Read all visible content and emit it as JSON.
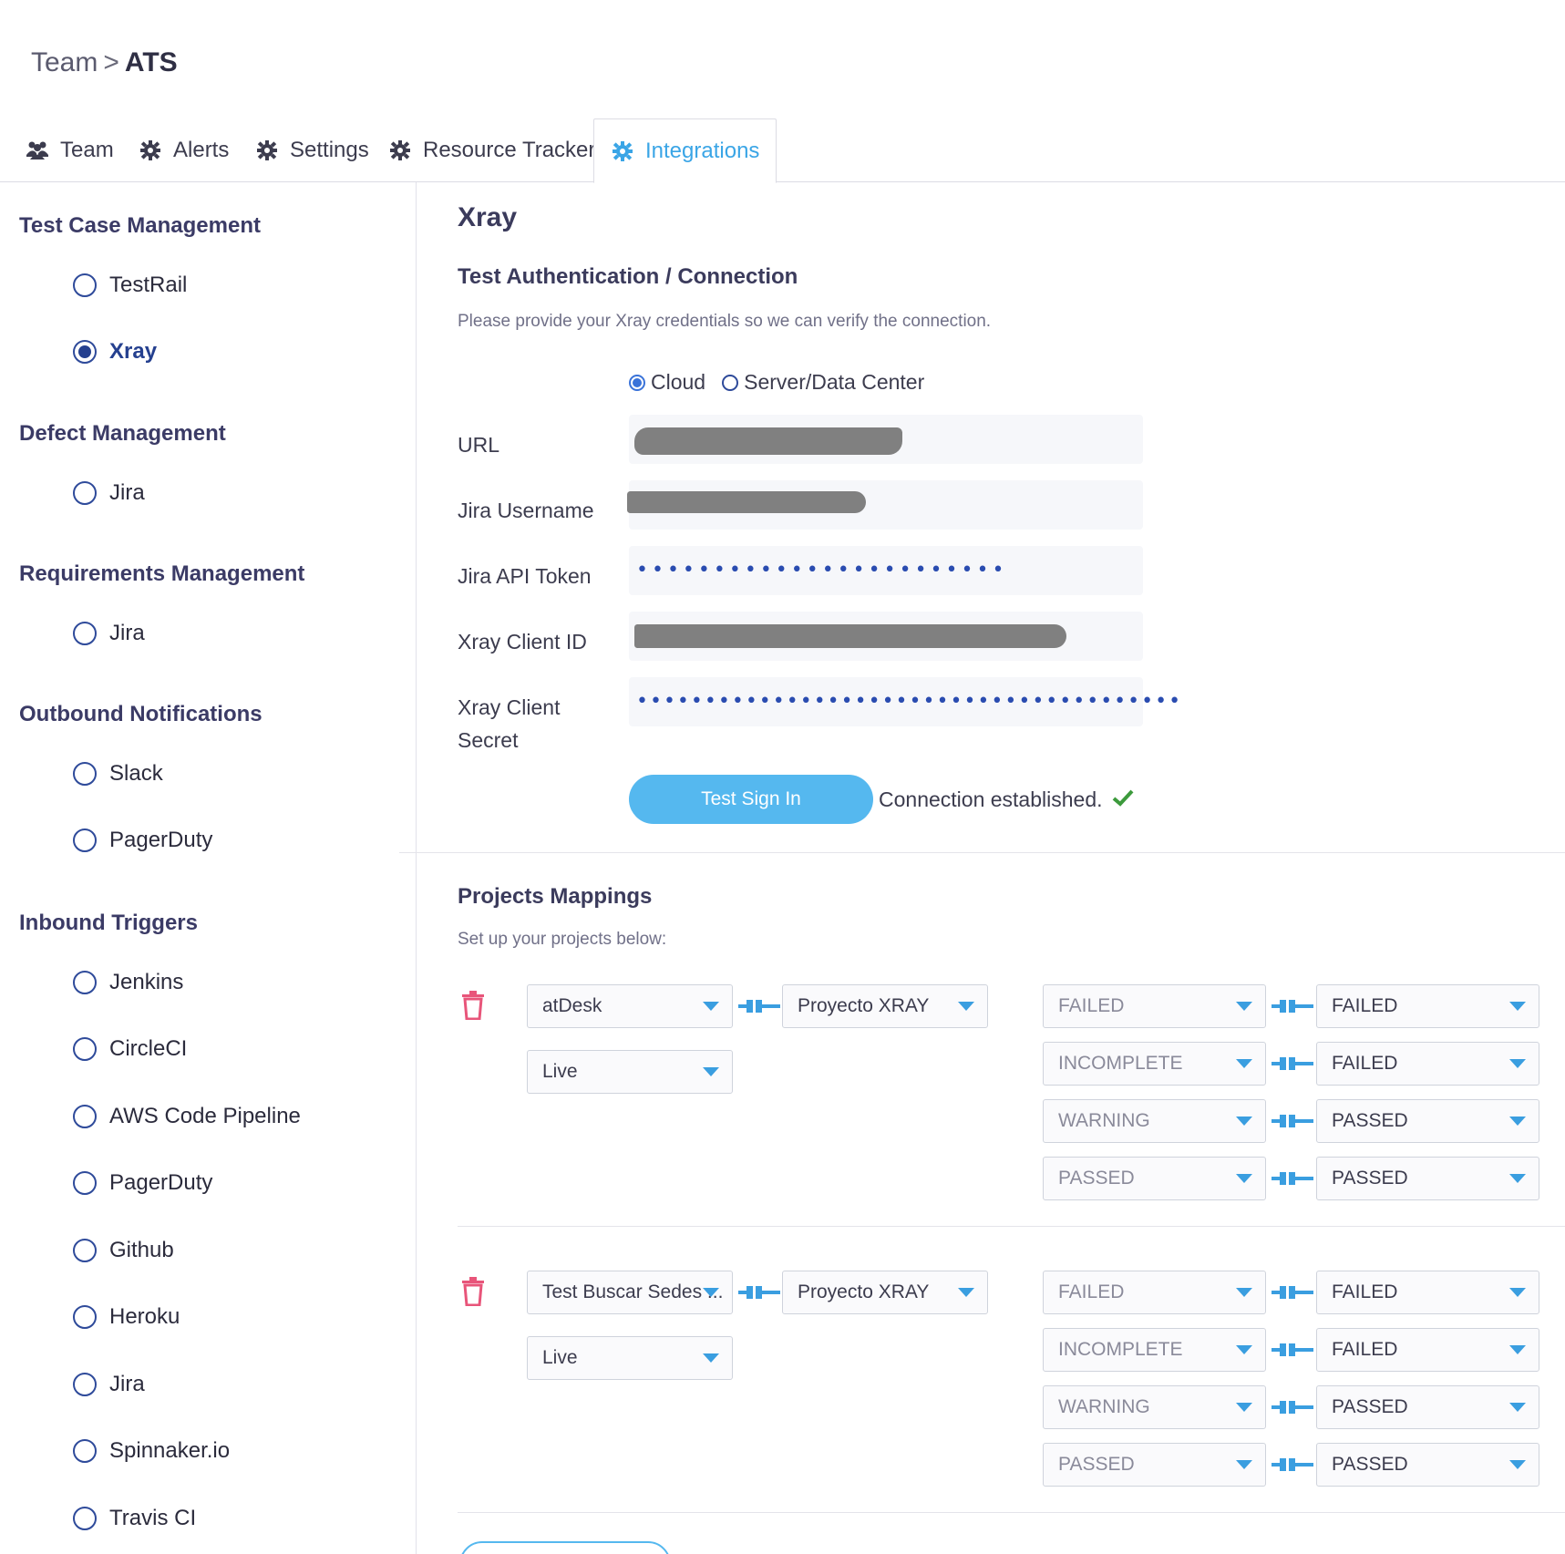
{
  "breadcrumb": {
    "parent": "Team",
    "separator": ">",
    "current": "ATS"
  },
  "tabs": [
    {
      "label": "Team",
      "icon": "users-icon"
    },
    {
      "label": "Alerts",
      "icon": "gear-icon"
    },
    {
      "label": "Settings",
      "icon": "gear-icon"
    },
    {
      "label": "Resource Tracker",
      "icon": "gear-icon"
    },
    {
      "label": "Integrations",
      "icon": "gear-icon",
      "active": true
    }
  ],
  "sidebar": {
    "groups": [
      {
        "title": "Test Case Management",
        "items": [
          {
            "label": "TestRail",
            "checked": false
          },
          {
            "label": "Xray",
            "checked": true
          }
        ]
      },
      {
        "title": "Defect Management",
        "items": [
          {
            "label": "Jira",
            "checked": false
          }
        ]
      },
      {
        "title": "Requirements Management",
        "items": [
          {
            "label": "Jira",
            "checked": false
          }
        ]
      },
      {
        "title": "Outbound Notifications",
        "items": [
          {
            "label": "Slack",
            "checked": false
          },
          {
            "label": "PagerDuty",
            "checked": false
          }
        ]
      },
      {
        "title": "Inbound Triggers",
        "items": [
          {
            "label": "Jenkins",
            "checked": false
          },
          {
            "label": "CircleCI",
            "checked": false
          },
          {
            "label": "AWS Code Pipeline",
            "checked": false
          },
          {
            "label": "PagerDuty",
            "checked": false
          },
          {
            "label": "Github",
            "checked": false
          },
          {
            "label": "Heroku",
            "checked": false
          },
          {
            "label": "Jira",
            "checked": false
          },
          {
            "label": "Spinnaker.io",
            "checked": false
          },
          {
            "label": "Travis CI",
            "checked": false
          }
        ]
      }
    ]
  },
  "main": {
    "title": "Xray",
    "auth": {
      "heading": "Test Authentication / Connection",
      "description": "Please provide your Xray credentials so we can verify the connection.",
      "mode_options": [
        "Cloud",
        "Server/Data Center"
      ],
      "mode_selected": "Cloud",
      "fields": {
        "url_label": "URL",
        "username_label": "Jira Username",
        "token_label": "Jira API Token",
        "token_value": "••••••••••••••••••••••••",
        "client_id_label": "Xray Client ID",
        "client_secret_label_1": "Xray Client",
        "client_secret_label_2": "Secret",
        "client_secret_value": "••••••••••••••••••••••••••••••••••••••••"
      },
      "test_button": "Test Sign In",
      "status": "Connection established.",
      "status_icon": "check-icon",
      "status_color": "#3c9a3c"
    },
    "mappings": {
      "heading": "Projects Mappings",
      "description": "Set up your projects below:",
      "rows": [
        {
          "source_project": "atDesk",
          "source_env": "Live",
          "target_project": "Proyecto XRAY",
          "status_map": [
            {
              "from": "FAILED",
              "to": "FAILED"
            },
            {
              "from": "INCOMPLETE",
              "to": "FAILED"
            },
            {
              "from": "WARNING",
              "to": "PASSED"
            },
            {
              "from": "PASSED",
              "to": "PASSED"
            }
          ]
        },
        {
          "source_project": "Test Buscar Sedes ...",
          "source_env": "Live",
          "target_project": "Proyecto XRAY",
          "status_map": [
            {
              "from": "FAILED",
              "to": "FAILED"
            },
            {
              "from": "INCOMPLETE",
              "to": "FAILED"
            },
            {
              "from": "WARNING",
              "to": "PASSED"
            },
            {
              "from": "PASSED",
              "to": "PASSED"
            }
          ]
        }
      ]
    }
  },
  "colors": {
    "accent": "#55b8ef",
    "radio": "#25408f",
    "delete": "#e8557a",
    "heading": "#3b3b66"
  }
}
